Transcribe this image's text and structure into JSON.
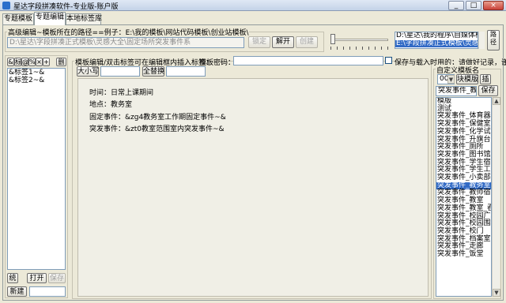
{
  "window": {
    "title": "星达字段拼凑软件-专业版-账户版",
    "minimize": "_",
    "maximize": "□",
    "close": "×"
  },
  "tabs": [
    "专题模板",
    "专题编辑",
    "本地标签库"
  ],
  "advanced": {
    "legend": "高级编辑~模板所在的路径==例子：E:\\我的模板\\网站代码模板\\创业站模板\\",
    "path_value": "D:\\星达\\字段拼凑正式模板\\灵感大全\\固定场所突发事件系",
    "lock_label": "锁定",
    "unlock_label": "解开",
    "create_label": "创建"
  },
  "template_paths": {
    "items": [
      "D:\\星达\\我的程序\\自媒体模板",
      "E:\\字段拼凑正式模板\\灵感大全"
    ],
    "path_label": "路径"
  },
  "left": {
    "toolbar": [
      "&",
      "标",
      "@",
      "%",
      "×",
      "+",
      "删"
    ],
    "items": [
      "&标签1~&",
      "&标签2~&"
    ],
    "stats_label": "统",
    "open_label": "打开",
    "save_label": "保存",
    "new_label": "新建"
  },
  "editor": {
    "legend": "模板编辑/双击标签可在编辑框内插入标签：",
    "password_label": "模板密码：",
    "right_hint": "保存与载入时用的；请做好记录，谨记!",
    "case_label": "大小写",
    "replace_all_label": "全替换",
    "lines": [
      "时间：日常上课期间",
      "地点：教务室",
      "固定事件：&zg4教务室工作期固定事件~&",
      "突发事件：&zt0教室范围室内突发事件~&"
    ]
  },
  "custom": {
    "legend": "自定义模板名",
    "index_value": "00",
    "block_label": "块模版",
    "insert_label": "插",
    "name_value": "突发事件_教务",
    "save_label": "保存",
    "selected_index": 11,
    "items": [
      "模版",
      "测试",
      "突发事件_体育器材室",
      "突发事件_保健室",
      "突发事件_化学试验室",
      "突发事件_升旗台",
      "突发事件_厕所",
      "突发事件_图书馆",
      "突发事件_学生宿舍",
      "突发事件_学生工作部",
      "突发事件_小卖部",
      "突发事件_教务室",
      "突发事件_教师宿舍",
      "突发事件_教室",
      "突发事件_教室_吞咽",
      "突发事件_校园广场",
      "突发事件_校园围墙处",
      "突发事件_校门",
      "突发事件_档案室",
      "突发事件_走廊",
      "突发事件_饭堂"
    ]
  },
  "colors": {
    "selection": "#316ac5",
    "panel_bg": "#ece9d8"
  }
}
